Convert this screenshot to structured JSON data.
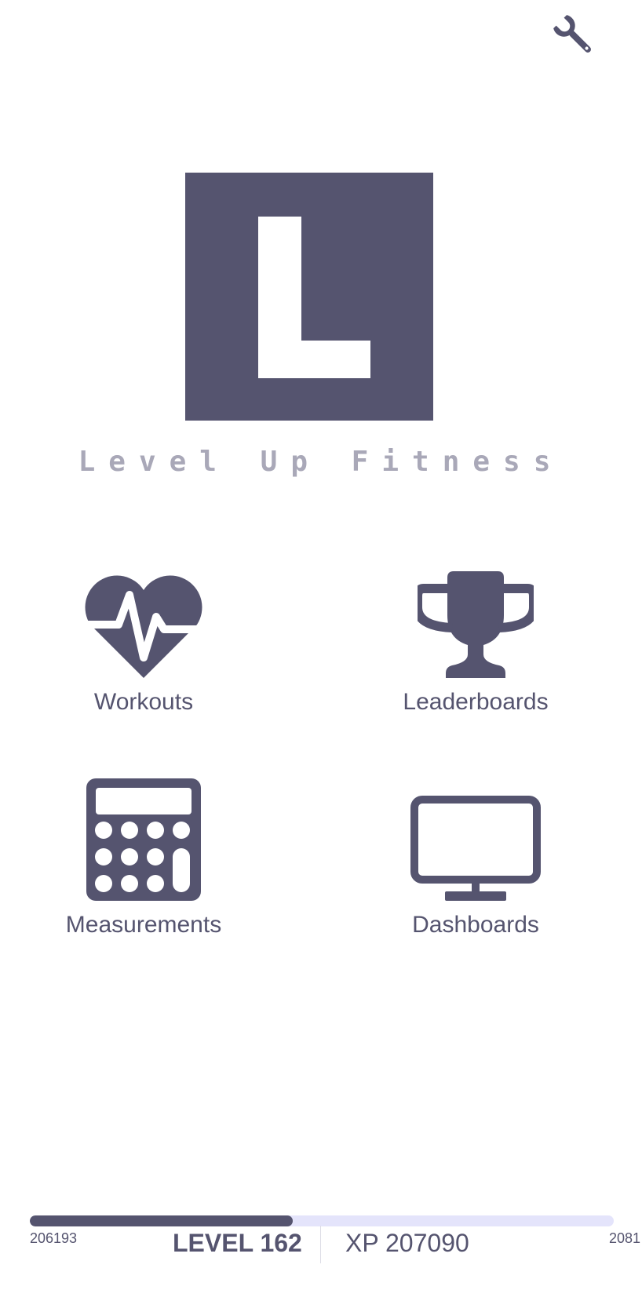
{
  "app": {
    "name": "Level Up Fitness",
    "logo_letter": "L"
  },
  "colors": {
    "primary": "#55546f",
    "subtitle": "#a9a8b8",
    "track": "#e4e4fb",
    "background": "#ffffff"
  },
  "header": {
    "settings_icon": "wrench-icon"
  },
  "menu": {
    "items": [
      {
        "label": "Workouts",
        "icon": "heartbeat-icon"
      },
      {
        "label": "Leaderboards",
        "icon": "trophy-icon"
      },
      {
        "label": "Measurements",
        "icon": "calculator-icon"
      },
      {
        "label": "Dashboards",
        "icon": "monitor-icon"
      }
    ]
  },
  "progress": {
    "level_label": "LEVEL 162",
    "xp_label": "XP 207090",
    "xp_min": "206193",
    "xp_max": "2081",
    "fill_fraction": 0.45
  }
}
